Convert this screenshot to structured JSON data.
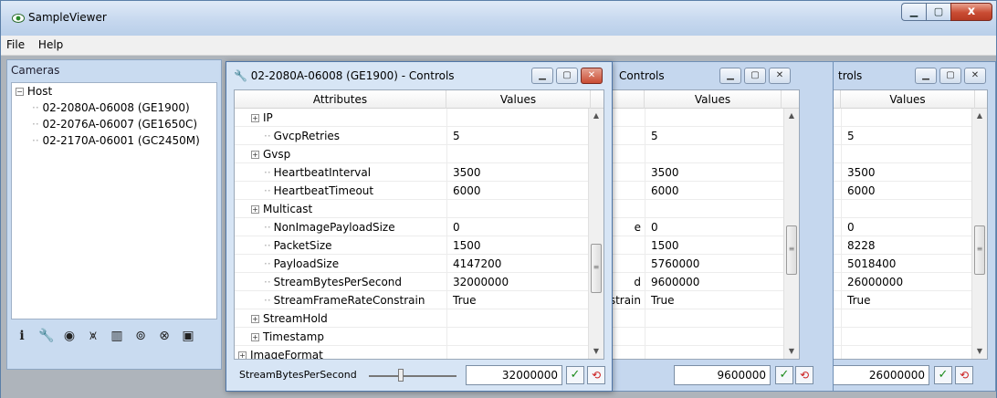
{
  "app": {
    "title": "SampleViewer"
  },
  "caption": {
    "close": "x"
  },
  "menu": {
    "items": [
      "File",
      "Help"
    ]
  },
  "cameras": {
    "caption": "Cameras",
    "root": "Host",
    "items": [
      "02-2080A-06008 (GE1900)",
      "02-2076A-06007 (GE1650C)",
      "02-2170A-06001 (GC2450M)"
    ]
  },
  "toolbar": {
    "icons": [
      "info-icon",
      "wrench-icon",
      "eye-icon",
      "waveform-icon",
      "histogram-icon",
      "focus-icon",
      "settings-icon",
      "save-icon"
    ],
    "info_glyph": "i"
  },
  "controls_front": {
    "title": "02-2080A-06008 (GE1900) - Controls",
    "col_attr": "Attributes",
    "col_val": "Values",
    "rows": [
      {
        "label": "IP",
        "value": "",
        "expand": true,
        "indent": 2
      },
      {
        "label": "GvcpRetries",
        "value": "5",
        "expand": false,
        "indent": 3
      },
      {
        "label": "Gvsp",
        "value": "",
        "expand": true,
        "indent": 2
      },
      {
        "label": "HeartbeatInterval",
        "value": "3500",
        "expand": false,
        "indent": 3
      },
      {
        "label": "HeartbeatTimeout",
        "value": "6000",
        "expand": false,
        "indent": 3
      },
      {
        "label": "Multicast",
        "value": "",
        "expand": true,
        "indent": 2
      },
      {
        "label": "NonImagePayloadSize",
        "value": "0",
        "expand": false,
        "indent": 3
      },
      {
        "label": "PacketSize",
        "value": "1500",
        "expand": false,
        "indent": 3
      },
      {
        "label": "PayloadSize",
        "value": "4147200",
        "expand": false,
        "indent": 3
      },
      {
        "label": "StreamBytesPerSecond",
        "value": "32000000",
        "expand": false,
        "indent": 3
      },
      {
        "label": "StreamFrameRateConstrain",
        "value": "True",
        "expand": false,
        "indent": 3
      },
      {
        "label": "StreamHold",
        "value": "",
        "expand": true,
        "indent": 2
      },
      {
        "label": "Timestamp",
        "value": "",
        "expand": true,
        "indent": 2
      },
      {
        "label": "ImageFormat",
        "value": "",
        "expand": true,
        "indent": 1
      }
    ],
    "bottom_name": "StreamBytesPerSecond",
    "bottom_value": "32000000"
  },
  "controls_mid": {
    "title": "Controls",
    "col_val": "Values",
    "rows": [
      {
        "label": "",
        "value": ""
      },
      {
        "label": "",
        "value": "5"
      },
      {
        "label": "",
        "value": ""
      },
      {
        "label": "",
        "value": "3500"
      },
      {
        "label": "",
        "value": "6000"
      },
      {
        "label": "",
        "value": ""
      },
      {
        "label": "e",
        "value": "0"
      },
      {
        "label": "",
        "value": "1500"
      },
      {
        "label": "",
        "value": "5760000"
      },
      {
        "label": "d",
        "value": "9600000"
      },
      {
        "label": "strain",
        "value": "True"
      },
      {
        "label": "",
        "value": ""
      },
      {
        "label": "",
        "value": ""
      },
      {
        "label": "",
        "value": ""
      }
    ],
    "bottom_value": "9600000"
  },
  "controls_back": {
    "title": "trols",
    "col_val": "Values",
    "rows": [
      {
        "value": ""
      },
      {
        "value": "5"
      },
      {
        "value": ""
      },
      {
        "value": "3500"
      },
      {
        "value": "6000"
      },
      {
        "value": ""
      },
      {
        "value": "0"
      },
      {
        "value": "8228"
      },
      {
        "value": "5018400"
      },
      {
        "value": "26000000"
      },
      {
        "value": "True"
      },
      {
        "value": ""
      },
      {
        "value": ""
      },
      {
        "value": ""
      }
    ],
    "bottom_value": "26000000"
  },
  "colors": {
    "title_bg": "#c5d7ee",
    "close_btn": "#c94c33",
    "client_bg": "#aeb4bb"
  }
}
